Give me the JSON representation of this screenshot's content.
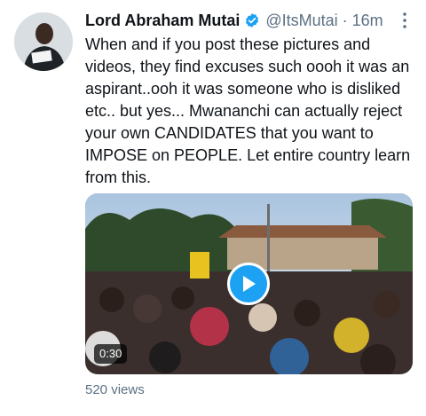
{
  "tweet": {
    "author_name": "Lord Abraham Mutai",
    "handle": "@ItsMutai",
    "separator": "·",
    "time": "16m",
    "text": "When and if you post these pictures and\nvideos, they find excuses such oooh it was an\naspirant..ooh it was someone who is disliked\netc.. but yes... Mwananchi can actually reject\nyour own CANDIDATES that you want to\nIMPOSE on PEOPLE. Let entire country learn\nfrom this.",
    "video_duration": "0:30",
    "views": "520 views"
  },
  "icons": {
    "verified": "verified-badge-icon",
    "more": "more-options-icon",
    "play": "play-icon"
  },
  "colors": {
    "accent": "#1da1f2",
    "secondary_text": "#5b7083"
  }
}
